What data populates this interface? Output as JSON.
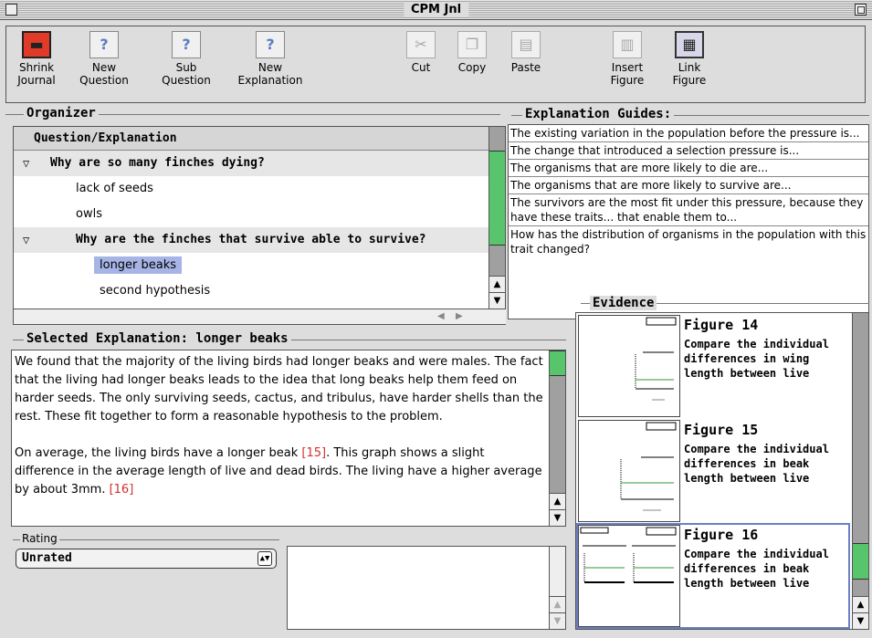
{
  "window": {
    "title": "CPM Jnl"
  },
  "toolbar": {
    "buttons": [
      {
        "label1": "Shrink",
        "label2": "Journal",
        "icon": "shrink-journal-icon"
      },
      {
        "label1": "New",
        "label2": "Question",
        "icon": "new-question-icon"
      },
      {
        "label1": "Sub",
        "label2": "Question",
        "icon": "sub-question-icon"
      },
      {
        "label1": "New",
        "label2": "Explanation",
        "icon": "new-explanation-icon"
      },
      {
        "label1": "Cut",
        "label2": "",
        "icon": "scissors-icon"
      },
      {
        "label1": "Copy",
        "label2": "",
        "icon": "copy-icon"
      },
      {
        "label1": "Paste",
        "label2": "",
        "icon": "paste-icon"
      },
      {
        "label1": "Insert",
        "label2": "Figure",
        "icon": "insert-figure-icon"
      },
      {
        "label1": "Link",
        "label2": "Figure",
        "icon": "link-figure-icon"
      }
    ]
  },
  "organizer": {
    "label": "Organizer",
    "column_header": "Question/Explanation",
    "q1": "Why are so many finches dying?",
    "q1_items": [
      "lack of seeds",
      "owls"
    ],
    "q2": "Why are the finches that survive able to survive?",
    "q2_items": [
      "longer beaks",
      "second hypothesis"
    ]
  },
  "guides": {
    "label": "Explanation Guides:",
    "items": [
      "The existing variation in the population before the pressure is...",
      "The change that introduced a selection pressure is...",
      "The organisms that are more likely to die are...",
      "The organisms that are more likely to survive are...",
      "The survivors are the most fit under this pressure, because they have these traits... that enable them to...",
      "How has the distribution of organisms in the population with this trait changed?"
    ]
  },
  "selected": {
    "label": "Selected Explanation: longer beaks",
    "para1": "We found that the majority of the living birds had longer beaks and were males.  The fact that the living had longer beaks leads to the idea that long beaks help them feed on harder seeds.  The only surviving seeds, cactus, and tribulus, have harder shells than the rest.  These fit together to form a reasonable hypothesis to the problem.",
    "para2_a": "On average, the living birds have a longer beak ",
    "ref1": "[15]",
    "para2_b": ".  This graph shows a slight difference in the average length of live and dead birds.  The living have a higher average by about 3mm. ",
    "ref2": "[16]"
  },
  "rating": {
    "label": "Rating",
    "value": "Unrated"
  },
  "evidence": {
    "label": "Evidence",
    "figures": [
      {
        "title": "Figure 14",
        "desc": "Compare the individual differences in wing length between live"
      },
      {
        "title": "Figure 15",
        "desc": "Compare the individual differences in beak length between live"
      },
      {
        "title": "Figure 16",
        "desc": "Compare the individual differences in beak length between live"
      }
    ]
  }
}
